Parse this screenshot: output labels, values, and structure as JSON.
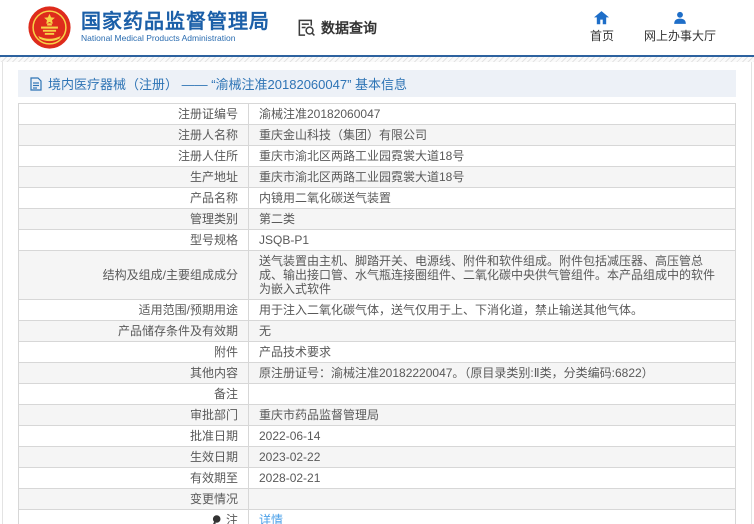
{
  "header": {
    "agency_name_cn": "国家药品监督管理局",
    "agency_name_en": "National Medical Products Administration",
    "data_query_label": "数据查询",
    "nav": [
      {
        "label": "首页",
        "icon": "home-icon"
      },
      {
        "label": "网上办事大厅",
        "icon": "person-icon"
      }
    ]
  },
  "breadcrumb": {
    "title": "境内医疗器械（注册） —— “渝械注准20182060047” 基本信息",
    "icon": "document-icon"
  },
  "table": {
    "rows": [
      {
        "label": "注册证编号",
        "value": "渝械注准20182060047"
      },
      {
        "label": "注册人名称",
        "value": "重庆金山科技（集团）有限公司"
      },
      {
        "label": "注册人住所",
        "value": "重庆市渝北区两路工业园霓裳大道18号"
      },
      {
        "label": "生产地址",
        "value": "重庆市渝北区两路工业园霓裳大道18号"
      },
      {
        "label": "产品名称",
        "value": "内镜用二氧化碳送气装置"
      },
      {
        "label": "管理类别",
        "value": "第二类"
      },
      {
        "label": "型号规格",
        "value": "JSQB-P1"
      },
      {
        "label": "结构及组成/主要组成成分",
        "value": "送气装置由主机、脚踏开关、电源线、附件和软件组成。附件包括减压器、高压管总成、输出接口管、水气瓶连接圈组件、二氧化碳中央供气管组件。本产品组成中的软件为嵌入式软件"
      },
      {
        "label": "适用范围/预期用途",
        "value": "用于注入二氧化碳气体，送气仅用于上、下消化道，禁止输送其他气体。"
      },
      {
        "label": "产品储存条件及有效期",
        "value": "无"
      },
      {
        "label": "附件",
        "value": "产品技术要求"
      },
      {
        "label": "其他内容",
        "value": "原注册证号：渝械注准20182220047。（原目录类别:Ⅱ类，分类编码:6822）"
      },
      {
        "label": "备注",
        "value": ""
      },
      {
        "label": "审批部门",
        "value": "重庆市药品监督管理局"
      },
      {
        "label": "批准日期",
        "value": "2022-06-14"
      },
      {
        "label": "生效日期",
        "value": "2023-02-22"
      },
      {
        "label": "有效期至",
        "value": "2028-02-21"
      },
      {
        "label": "变更情况",
        "value": ""
      },
      {
        "label": "注",
        "value": "详情",
        "link": true,
        "note_icon": true
      }
    ]
  },
  "colors": {
    "accent_blue": "#1b5fa8",
    "link_blue": "#4ba0e8",
    "emblem_red": "#de2b1c",
    "emblem_gold": "#f7d247",
    "crumb_bg": "#edf1f7",
    "row_alt_bg": "#f5f5f5",
    "divider_blue": "#2d629f"
  }
}
